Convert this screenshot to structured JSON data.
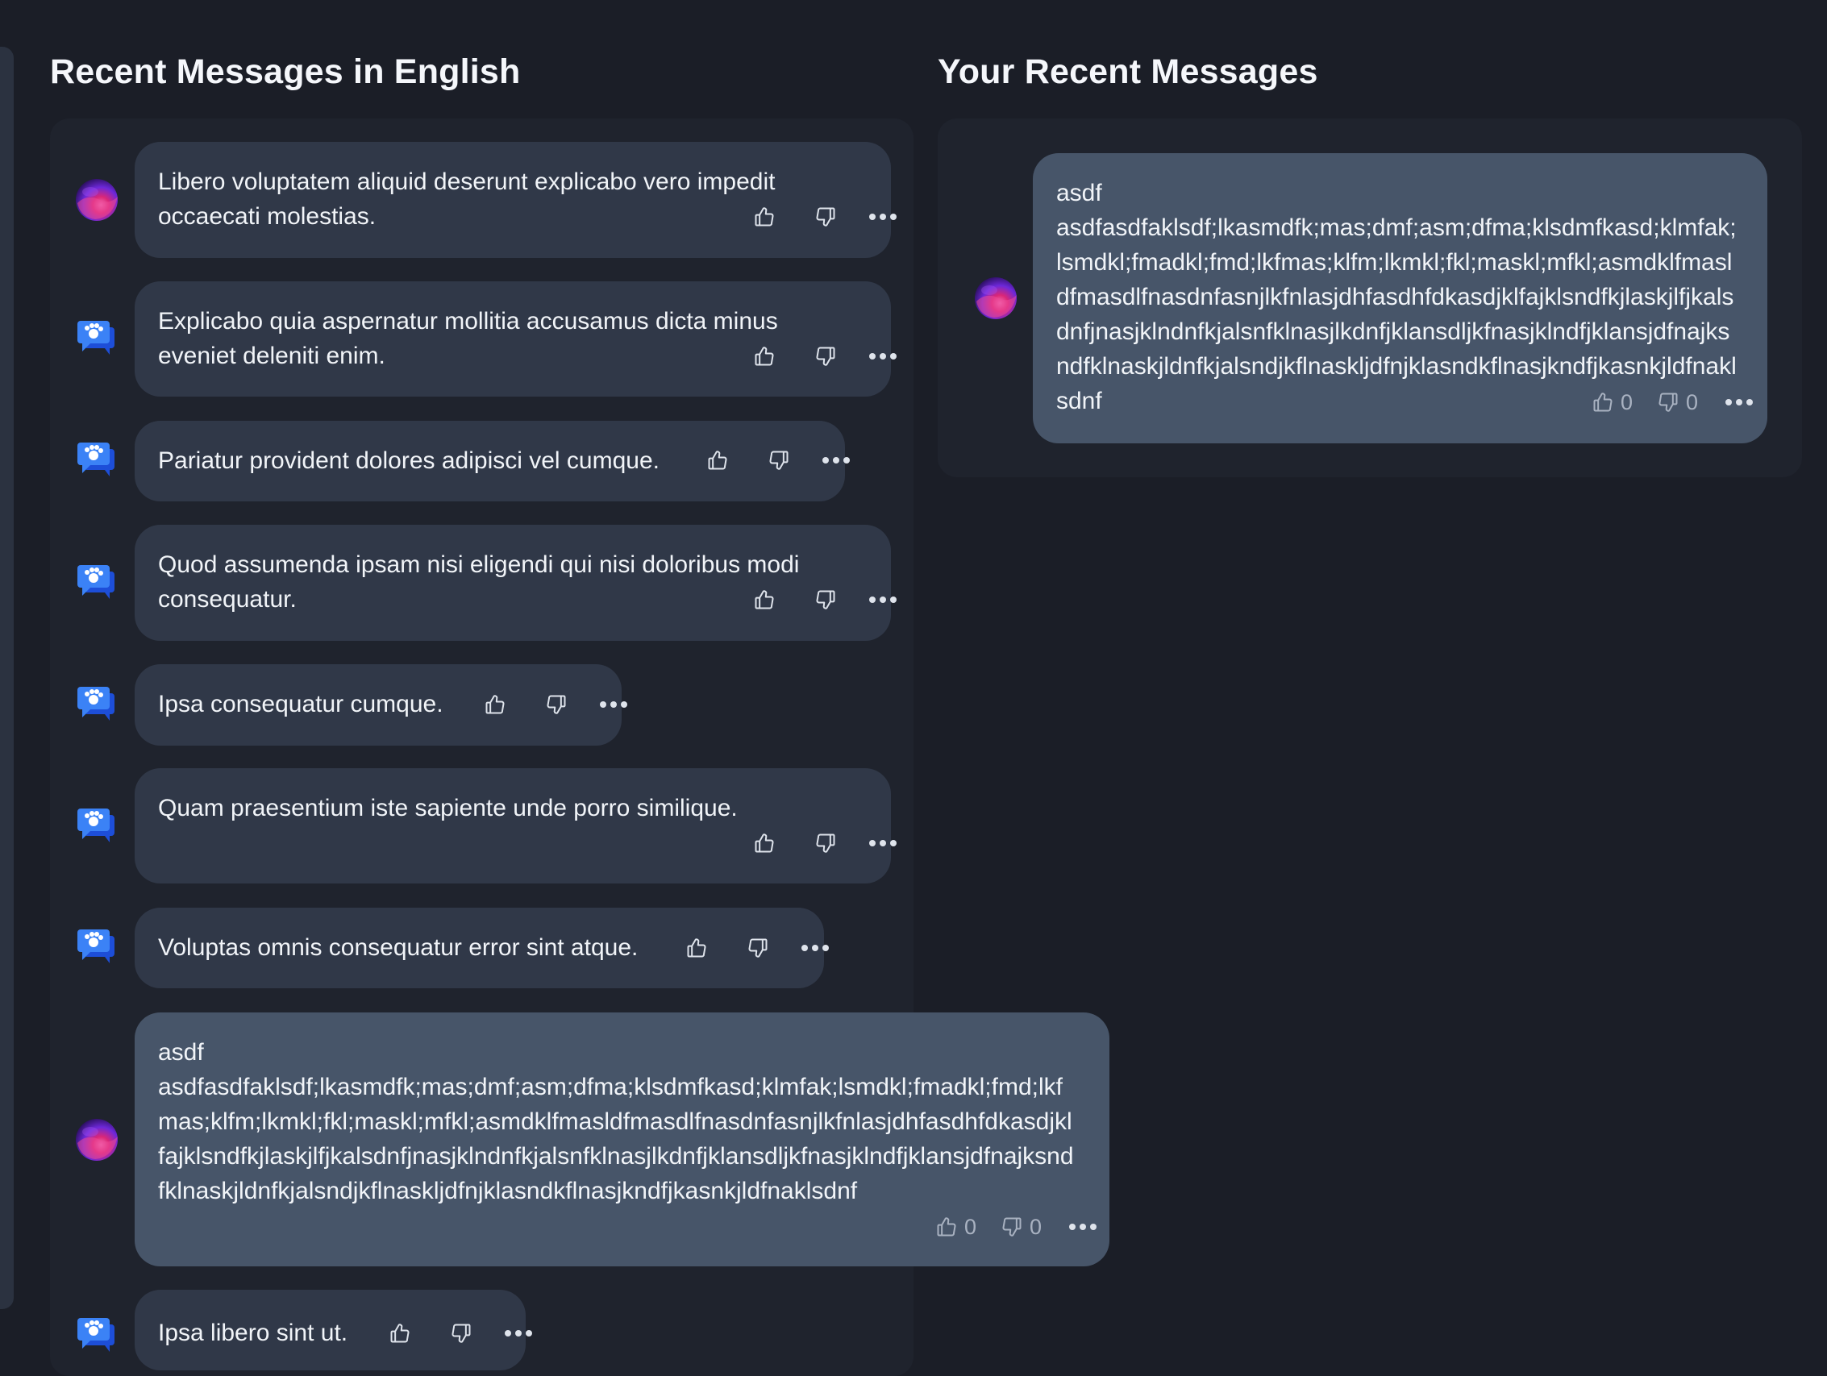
{
  "sections": {
    "left_title": "Recent Messages in English",
    "right_title": "Your Recent Messages"
  },
  "messages": [
    {
      "text": "Libero voluptatem aliquid deserunt explicabo vero impedit occaecati molestias.",
      "avatar": "gradient-orb-avatar"
    },
    {
      "text": "Explicabo quia aspernatur mollitia accusamus dicta minus eveniet deleniti enim.",
      "avatar": "chat-bot-icon"
    },
    {
      "text": "Pariatur provident dolores adipisci vel cumque.",
      "avatar": "chat-bot-icon"
    },
    {
      "text": "Quod assumenda ipsam nisi eligendi qui nisi doloribus modi consequatur.",
      "avatar": "chat-bot-icon"
    },
    {
      "text": "Ipsa consequatur cumque.",
      "avatar": "chat-bot-icon"
    },
    {
      "text": "Quam praesentium iste sapiente unde porro similique.",
      "avatar": "chat-bot-icon"
    },
    {
      "text": "Voluptas omnis consequatur error sint atque.",
      "avatar": "chat-bot-icon"
    },
    {
      "text_line1": "asdf",
      "text_rest": "asdfasdfaklsdf;lkasmdfk;mas;dmf;asm;dfma;klsdmfkasd;klmfak;lsmdkl;fmadkl;fmd;lkfmas;klfm;lkmkl;fkl;maskl;mfkl;asmdklfmasldfmasdlfnasdnfasnjlkfnlasjdhfasdhfdkasdjklfajklsndfkjlaskjlfjkalsdnfjnasjklndnfkjalsnfklnasjlkdnfjklansdljkfnasjklndfjklansjdfnajksndfklnaskjldnfkjalsndjkflnaskljdfnjklasndkflnasjkndfjkasnkjldfnaklsdnf",
      "likes": "0",
      "dislikes": "0",
      "avatar": "gradient-orb-avatar"
    },
    {
      "text": "Ipsa libero sint ut.",
      "avatar": "chat-bot-icon"
    }
  ],
  "your_messages": [
    {
      "text_line1": "asdf",
      "text_rest": "asdfasdfaklsdf;lkasmdfk;mas;dmf;asm;dfma;klsdmfkasd;klmfak;lsmdkl;fmadkl;fmd;lkfmas;klfm;lkmkl;fkl;maskl;mfkl;asmdklfmasldfmasdlfnasdnfasnjlkfnlasjdhfasdhfdkasdjklfajklsndfkjlaskjlfjkalsdnfjnasjklndnfkjalsnfklnasjlkdnfjklansdljkfnasjklndfjklansjdfnajksndfklnaskjldnfkjalsndjkflnaskljdfnjklasndkflnasjkndfjkasnkjldfnaklsdnf",
      "likes": "0",
      "dislikes": "0",
      "avatar": "gradient-orb-avatar"
    }
  ],
  "colors": {
    "background": "#1b1e27",
    "panel": "#1f232d",
    "bubble": "#303848",
    "own_bubble": "#475569",
    "bot_icon_blue": "#3b82f6",
    "orb_pink": "#ec4899",
    "orb_purple": "#5b21b6"
  }
}
